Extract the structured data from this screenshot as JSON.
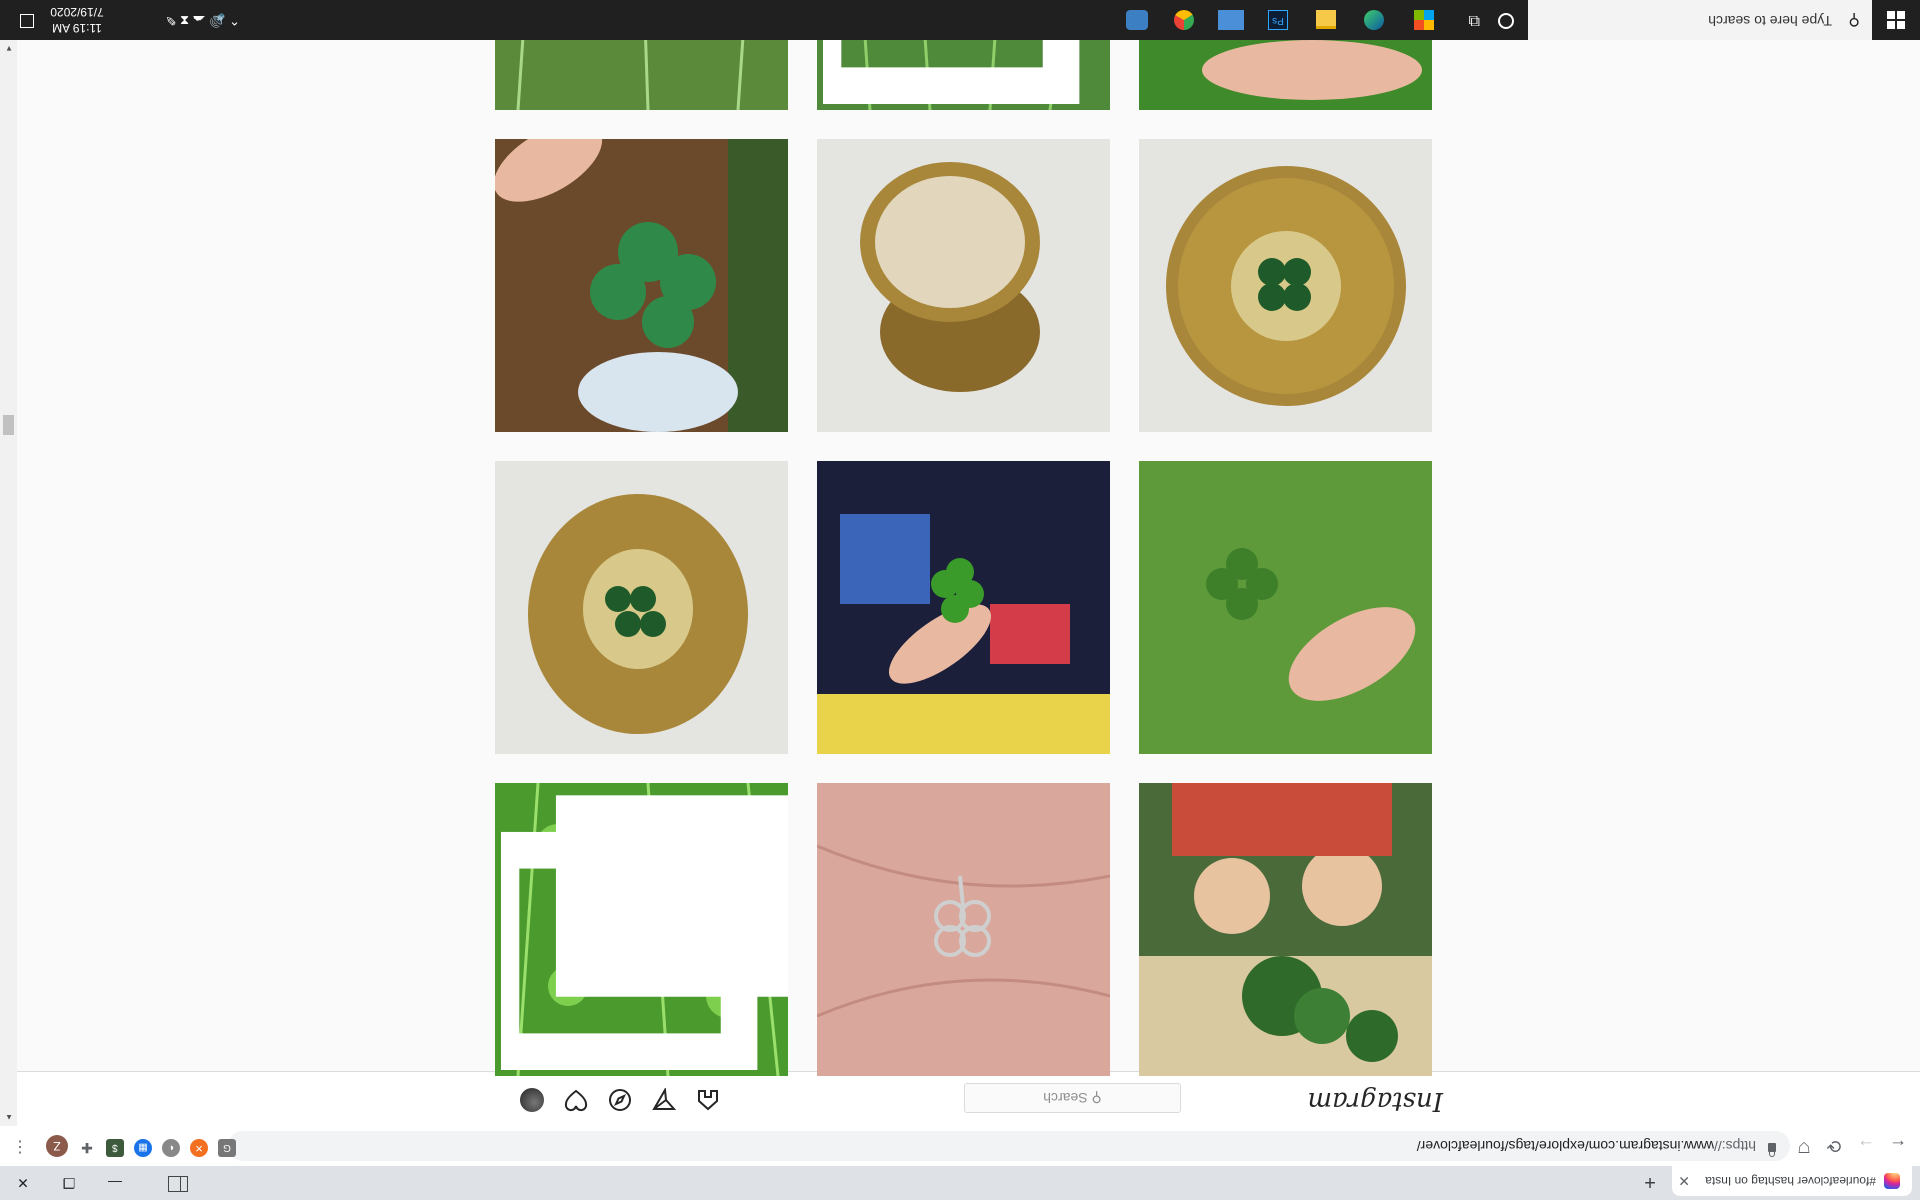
{
  "browser": {
    "tab_title": "#fourleafclover hashtag on Insta",
    "new_tab_symbol": "+",
    "url_scheme": "https://",
    "url_rest": "www.instagram.com/explore/tags/fourleafclover/",
    "profile_initial": "Z"
  },
  "taskbar": {
    "search_placeholder": "Type here to search",
    "time": "11:19 AM",
    "date": "7/19/2020"
  },
  "instagram": {
    "logo": "Instagram",
    "search_placeholder": "Search",
    "search_icon": "⚲"
  },
  "posts": [
    {
      "subject": "vintage-illustration-clover"
    },
    {
      "subject": "silver-clover-charm-on-palm"
    },
    {
      "subject": "clover-patch-in-grass",
      "multiple": true
    },
    {
      "subject": "hand-holding-clover-on-lawn"
    },
    {
      "subject": "clover-over-comic-book"
    },
    {
      "subject": "brass-compact-with-clovers"
    },
    {
      "subject": "brass-compact-closed"
    },
    {
      "subject": "brass-compact-open"
    },
    {
      "subject": "hand-holding-clover-wood"
    },
    {
      "subject": "hand-over-clover-patch"
    },
    {
      "subject": "grass-closeup",
      "multiple": true
    },
    {
      "subject": "grass-and-flowers"
    }
  ],
  "colors": {
    "taskbar": "#202020",
    "ig_text": "#262626",
    "grass": "#4a9a2e",
    "brass": "#a8873a"
  }
}
